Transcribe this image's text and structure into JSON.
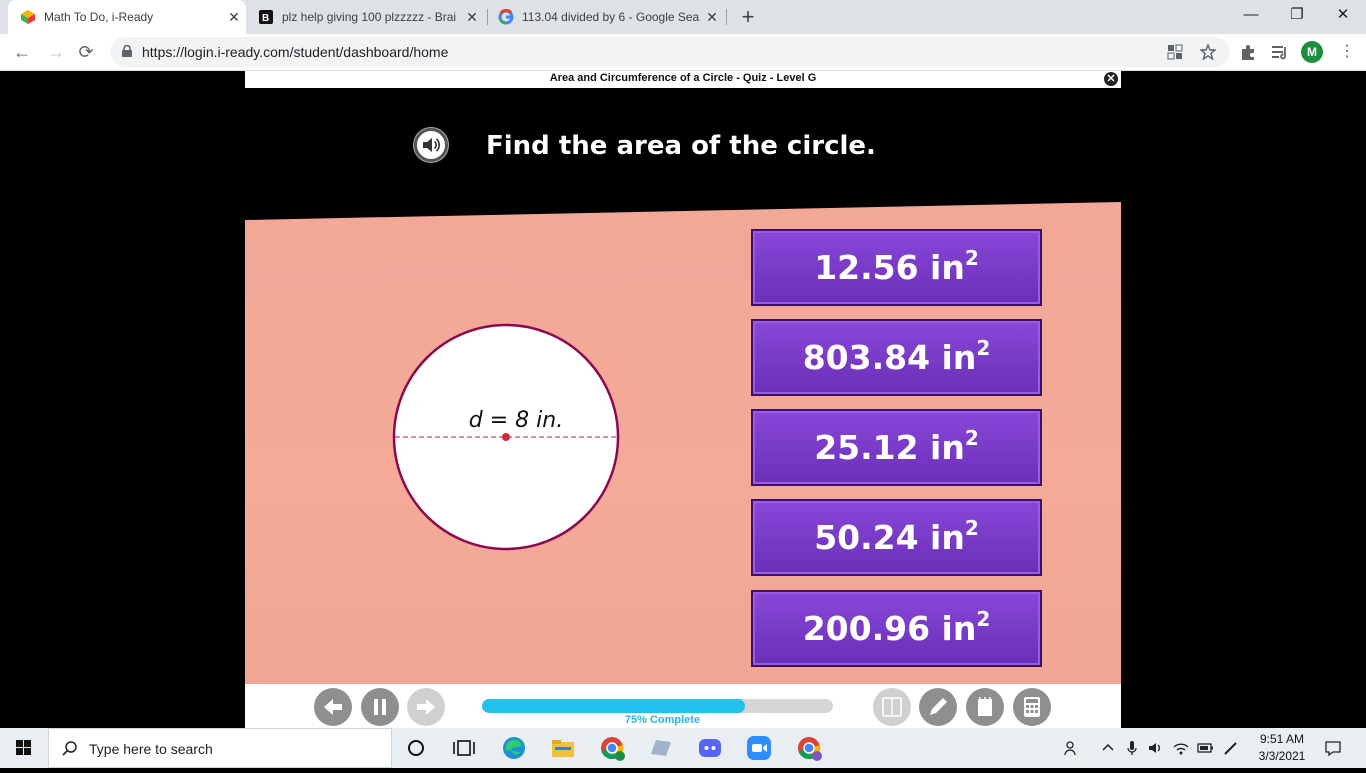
{
  "browser": {
    "tabs": [
      {
        "title": "Math To Do, i-Ready",
        "active": true
      },
      {
        "title": "plz help giving 100 plzzzzz - Brai",
        "active": false
      },
      {
        "title": "113.04 divided by 6 - Google Sea",
        "active": false
      }
    ],
    "url": "https://login.i-ready.com/student/dashboard/home",
    "profile_initial": "M"
  },
  "lesson": {
    "title": "Area and Circumference of a Circle - Quiz - Level G",
    "question": "Find the area of the circle.",
    "figure_label": "d = 8 in.",
    "answers": [
      {
        "value": "12.56 in",
        "exp": "2"
      },
      {
        "value": "803.84 in",
        "exp": "2"
      },
      {
        "value": "25.12 in",
        "exp": "2"
      },
      {
        "value": "50.24 in",
        "exp": "2"
      },
      {
        "value": "200.96 in",
        "exp": "2"
      }
    ],
    "progress_percent": 75,
    "progress_label": "75% Complete"
  },
  "taskbar": {
    "search_placeholder": "Type here to search",
    "time": "9:51 AM",
    "date": "3/3/2021"
  },
  "colors": {
    "answer_purple": "#7a3bc8",
    "panel_salmon": "#f2a797",
    "progress_blue": "#25c1ee",
    "circle_stroke": "#8b0a4f"
  }
}
